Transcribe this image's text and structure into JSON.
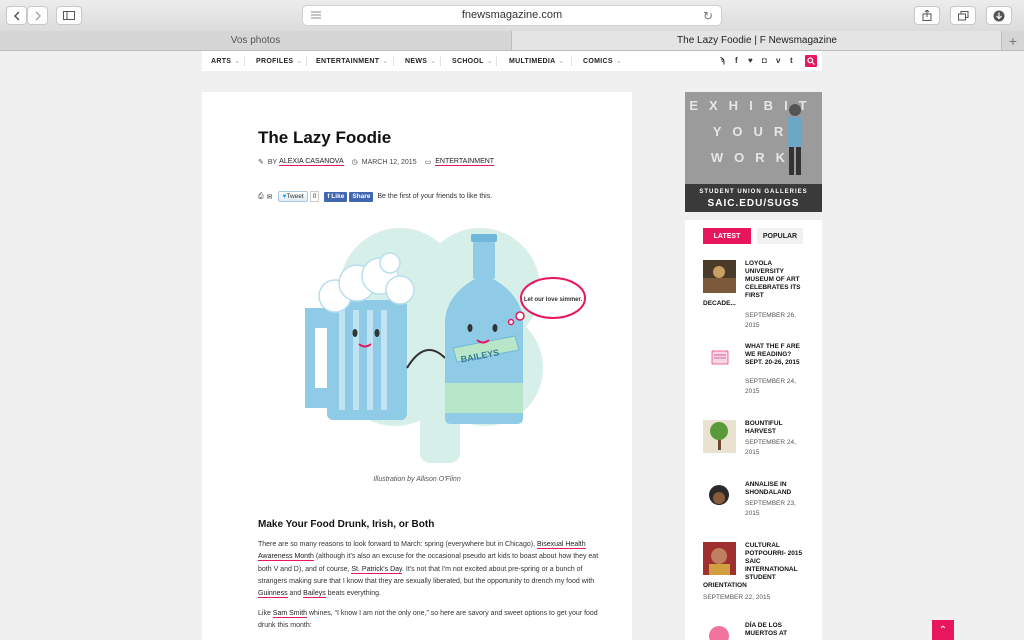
{
  "browser": {
    "url": "fnewsmagazine.com",
    "tabs": [
      {
        "label": "Vos photos"
      },
      {
        "label": "The Lazy Foodie | F Newsmagazine"
      }
    ],
    "new_tab": "+"
  },
  "nav": {
    "items": [
      "ARTS",
      "PROFILES",
      "ENTERTAINMENT",
      "NEWS",
      "SCHOOL",
      "MULTIMEDIA",
      "COMICS"
    ],
    "social_icons": [
      "rss-icon",
      "facebook-icon",
      "twitter-icon",
      "instagram-icon",
      "vimeo-icon",
      "tumblr-icon"
    ]
  },
  "article": {
    "title": "The Lazy Foodie",
    "by": "BY",
    "author": "ALEXIA CASANOVA",
    "date": "MARCH 12, 2015",
    "category": "ENTERTAINMENT",
    "tweet": "Tweet",
    "tweet_count": "0",
    "fb_like": "Like",
    "fb_share": "Share",
    "fb_text": "Be the first of your friends to like this.",
    "bubble_text": "Let our love simmer.",
    "bottle_label": "BAILEYS",
    "caption": "Illustration by Allison O'Flinn",
    "heading": "Make Your Food Drunk, Irish, or Both",
    "p1": {
      "t1": "There are so many reasons to look forward to March: spring (everywhere but in Chicago), ",
      "l1": "Bisexual Health Awareness Month",
      "t2": " (although it's also an excuse for the occasional pseudo art kids to boast about how they eat both V and D), and of course, ",
      "l2": "St. Patrick's Day",
      "t3": ". It's not that I'm not excited about pre-spring or a bunch of strangers making sure that I know that they are sexually liberated, but the opportunity to drench my food with ",
      "l3": "Guinness",
      "t4": " and ",
      "l4": "Baileys",
      "t5": " beats everything."
    },
    "p2": {
      "t1": "Like ",
      "l1": "Sam Smith",
      "t2": " whines, “I know I am not the only one,” so here are savory and sweet options to get your food drunk this month:"
    }
  },
  "ad": {
    "line_a": "EXHIBIT",
    "line_b": "YOUR",
    "line_c": "WORK",
    "line1": "STUDENT UNION GALLERIES",
    "line2": "SAIC.EDU/SUGS"
  },
  "sidebar": {
    "tab_latest": "LATEST",
    "tab_popular": "POPULAR",
    "posts": [
      {
        "title": "LOYOLA UNIVERSITY MUSEUM OF ART CELEBRATES ITS FIRST",
        "title_cont": "DECADE...",
        "date": "SEPTEMBER 26, 2015"
      },
      {
        "title": "WHAT THE F ARE WE READING? SEPT. 20-26, 2015",
        "date": "SEPTEMBER 24, 2015"
      },
      {
        "title": "BOUNTIFUL HARVEST",
        "date": "SEPTEMBER 24, 2015"
      },
      {
        "title": "ANNALISE IN SHONDALAND",
        "date": "SEPTEMBER 23, 2015"
      },
      {
        "title": "CULTURAL POTPOURRI- 2015 SAIC INTERNATIONAL STUDENT",
        "title_cont": "ORIENTATION",
        "date": "SEPTEMBER 22, 2015"
      },
      {
        "title": "DÍA DE LOS MUERTOS AT"
      }
    ]
  },
  "colors": {
    "accent": "#e8175d",
    "beer": "#7ec8e3",
    "clover": "#d6eee8"
  }
}
